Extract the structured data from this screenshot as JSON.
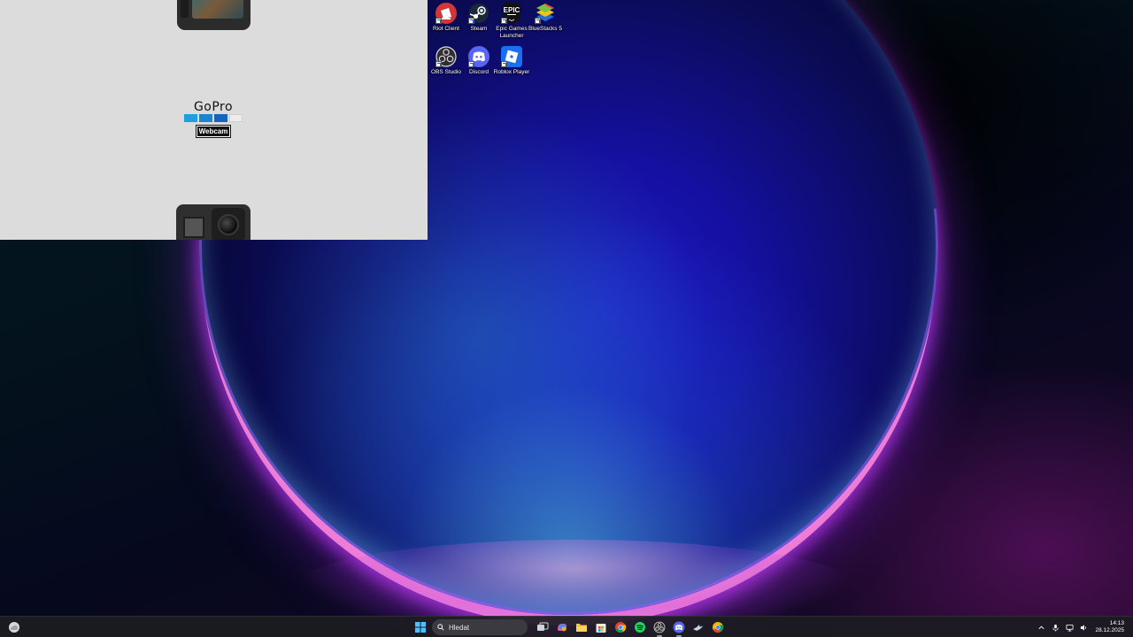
{
  "gopro_window": {
    "brand": "GoPro",
    "product": "Webcam"
  },
  "desktop_icons": [
    {
      "label": "Riot Client",
      "icon": "riot-client-icon",
      "color": "#d13639"
    },
    {
      "label": "Steam",
      "icon": "steam-icon",
      "color": "#1b2838"
    },
    {
      "label": "Epic Games Launcher",
      "icon": "epic-games-icon",
      "color": "#121212"
    },
    {
      "label": "BlueStacks 5",
      "icon": "bluestacks-icon",
      "color": "#7ac142"
    },
    {
      "label": "OBS Studio",
      "icon": "obs-studio-icon",
      "color": "#302e31"
    },
    {
      "label": "Discord",
      "icon": "discord-icon",
      "color": "#5865f2"
    },
    {
      "label": "Roblox Player",
      "icon": "roblox-icon",
      "color": "#1a6ef0"
    }
  ],
  "epic_logo_text": "EPIC",
  "taskbar": {
    "search_placeholder": "Hledat",
    "apps": [
      {
        "name": "task-view-icon",
        "active": false
      },
      {
        "name": "copilot-icon",
        "active": false
      },
      {
        "name": "file-explorer-icon",
        "active": false
      },
      {
        "name": "microsoft-store-icon",
        "active": false
      },
      {
        "name": "chrome-icon",
        "active": false
      },
      {
        "name": "spotify-icon",
        "active": false
      },
      {
        "name": "obs-studio-icon",
        "active": true
      },
      {
        "name": "discord-icon",
        "active": true
      },
      {
        "name": "steam-icon",
        "active": false
      },
      {
        "name": "chrome-canary-icon",
        "active": false
      }
    ],
    "tray": [
      "chevron-up-icon",
      "microphone-icon",
      "network-icon",
      "volume-icon"
    ],
    "time": "14:13",
    "date": "28.12.2025"
  }
}
